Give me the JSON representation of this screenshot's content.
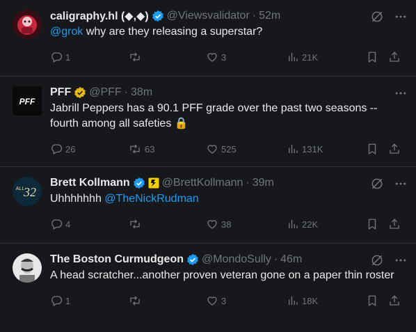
{
  "tweets": [
    {
      "name": "caligraphy.hl (◆,◆)",
      "handle": "@Viewsvalidator",
      "dot": "·",
      "time": "52m",
      "text_mention": "@grok",
      "text_rest": " why are they releasing a superstar?",
      "replies": "1",
      "reposts": "",
      "likes": "3",
      "views": "21K",
      "badge": "blue-check-icon",
      "avatar": "red-character-avatar"
    },
    {
      "name": "PFF",
      "handle": "@PFF",
      "dot": "·",
      "time": "38m",
      "text": "Jabrill Peppers has a 90.1 PFF grade over the past two seasons -- fourth among all safeties 🔒",
      "replies": "26",
      "reposts": "63",
      "likes": "525",
      "views": "131K",
      "badge": "gold-check-icon",
      "avatar_text": "PFF"
    },
    {
      "name": "Brett Kollmann",
      "handle": "@BrettKollmann",
      "dot": "·",
      "time": "39m",
      "text_plain": "Uhhhhhhh ",
      "text_mention": "@TheNickRudman",
      "replies": "4",
      "reposts": "",
      "likes": "38",
      "views": "22K",
      "badge": "blue-check-icon",
      "affiliate": "affiliate-badge-icon",
      "avatar_text": "ALL",
      "avatar_num": "32"
    },
    {
      "name": "The Boston Curmudgeon",
      "handle": "@MondoSully",
      "dot": "·",
      "time": "46m",
      "text": "A head scratcher...another proven veteran gone on a paper thin roster",
      "replies": "1",
      "reposts": "",
      "likes": "3",
      "views": "18K",
      "badge": "blue-check-icon",
      "avatar": "mustache-man-avatar"
    }
  ],
  "colors": {
    "bg": "#16181c",
    "text": "#e7e9ea",
    "muted": "#71767b",
    "link": "#1d9bf0",
    "border": "#2f3336",
    "gold": "#e2b719"
  }
}
